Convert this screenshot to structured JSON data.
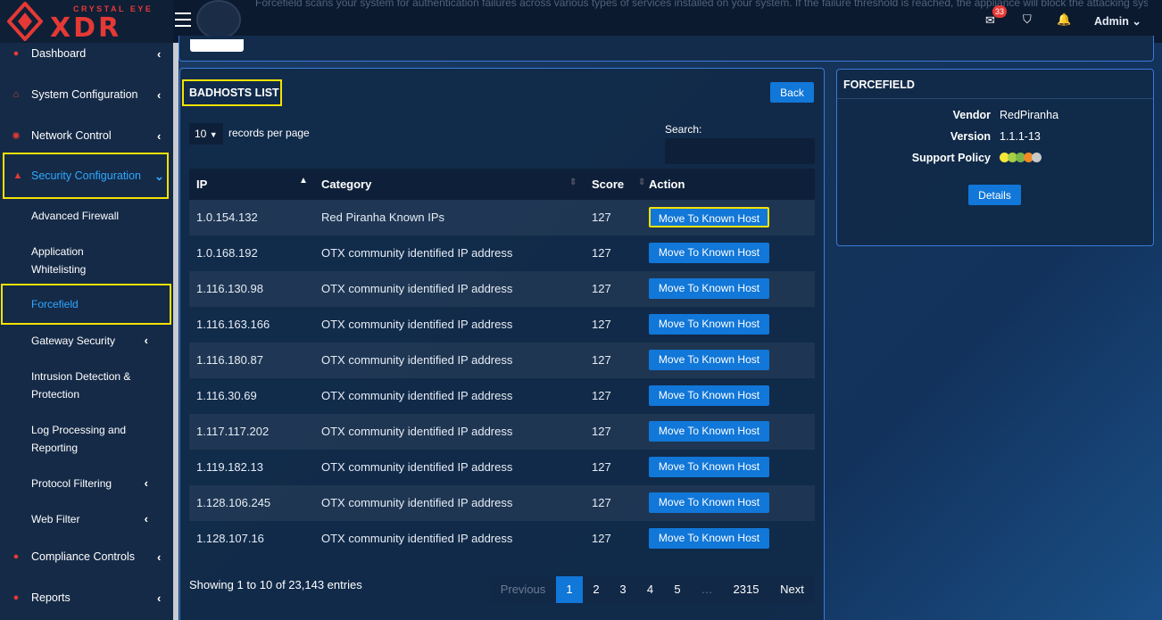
{
  "brand": {
    "tagline": "CRYSTAL EYE",
    "name": "XDR"
  },
  "topbar": {
    "description": "Forcefield scans your system for authentication failures across various types of services installed on your system. If the failure threshold is reached, the appliance will block the attacking system.",
    "notification_count": "33",
    "user": "Admin"
  },
  "sidebar": {
    "items": [
      {
        "label": "Dashboard",
        "icon": "dashboard-icon"
      },
      {
        "label": "System Configuration",
        "icon": "home-icon"
      },
      {
        "label": "Network Control",
        "icon": "network-icon"
      },
      {
        "label": "Security Configuration",
        "icon": "shield-icon"
      },
      {
        "label": "Compliance Controls",
        "icon": "compliance-icon"
      },
      {
        "label": "Reports",
        "icon": "reports-icon"
      }
    ],
    "security_sub": [
      "Advanced Firewall",
      "Application Whitelisting",
      "Forcefield",
      "Gateway Security",
      "Intrusion Detection & Protection",
      "Log Processing and Reporting",
      "Protocol Filtering",
      "Web Filter"
    ]
  },
  "badhosts": {
    "title": "BADHOSTS LIST",
    "back_label": "Back",
    "page_size": "10",
    "page_size_label": "records per page",
    "search_label": "Search:",
    "search_value": "",
    "columns": {
      "ip": "IP",
      "category": "Category",
      "score": "Score",
      "action": "Action"
    },
    "action_label": "Move To Known Host",
    "rows": [
      {
        "ip": "1.0.154.132",
        "category": "Red Piranha Known IPs",
        "score": "127"
      },
      {
        "ip": "1.0.168.192",
        "category": "OTX community identified IP address",
        "score": "127"
      },
      {
        "ip": "1.116.130.98",
        "category": "OTX community identified IP address",
        "score": "127"
      },
      {
        "ip": "1.116.163.166",
        "category": "OTX community identified IP address",
        "score": "127"
      },
      {
        "ip": "1.116.180.87",
        "category": "OTX community identified IP address",
        "score": "127"
      },
      {
        "ip": "1.116.30.69",
        "category": "OTX community identified IP address",
        "score": "127"
      },
      {
        "ip": "1.117.117.202",
        "category": "OTX community identified IP address",
        "score": "127"
      },
      {
        "ip": "1.119.182.13",
        "category": "OTX community identified IP address",
        "score": "127"
      },
      {
        "ip": "1.128.106.245",
        "category": "OTX community identified IP address",
        "score": "127"
      },
      {
        "ip": "1.128.107.16",
        "category": "OTX community identified IP address",
        "score": "127"
      }
    ],
    "info": "Showing 1 to 10 of 23,143 entries",
    "pagination": {
      "previous": "Previous",
      "pages": [
        "1",
        "2",
        "3",
        "4",
        "5",
        "…",
        "2315"
      ],
      "next": "Next"
    }
  },
  "forcefield": {
    "title": "FORCEFIELD",
    "vendor_label": "Vendor",
    "vendor": "RedPiranha",
    "version_label": "Version",
    "version": "1.1.1-13",
    "support_label": "Support Policy",
    "support_colors": [
      "#f5e73a",
      "#a8cf45",
      "#7ab648",
      "#f08a24",
      "#c9c9c9"
    ],
    "details_label": "Details"
  },
  "colors": {
    "accent": "#1177d8",
    "highlight": "#f5e200",
    "brand_red": "#e53935"
  }
}
